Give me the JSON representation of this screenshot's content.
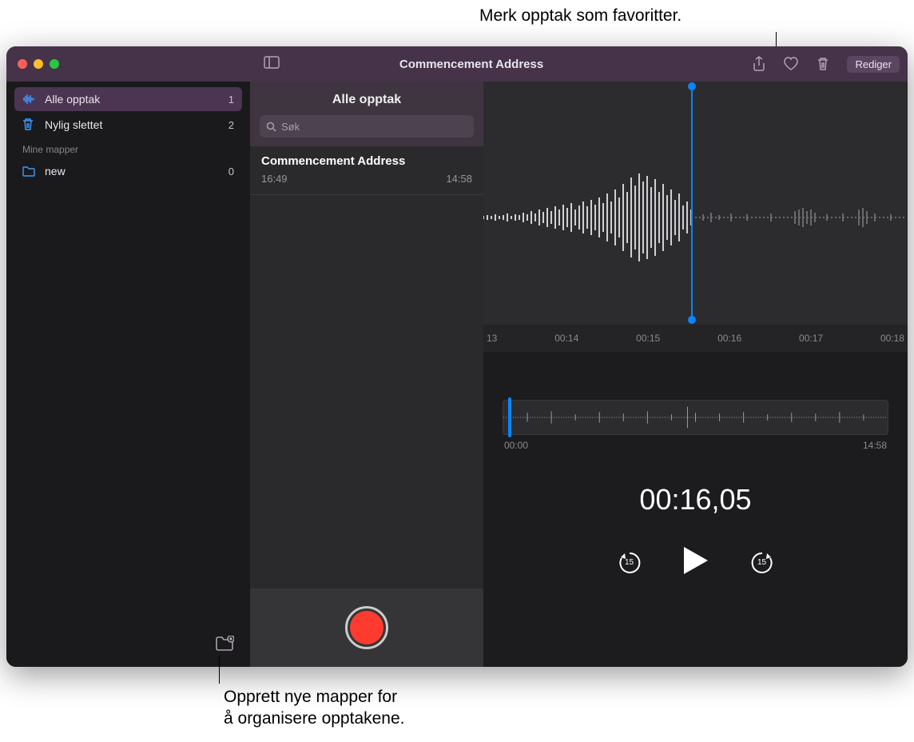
{
  "callouts": {
    "top": "Merk opptak som favoritter.",
    "bottom": "Opprett nye mapper for\nå organisere opptakene."
  },
  "titlebar": {
    "title": "Commencement Address",
    "edit_label": "Rediger"
  },
  "sidebar": {
    "items": [
      {
        "icon": "waveform",
        "label": "Alle opptak",
        "count": "1",
        "selected": true
      },
      {
        "icon": "trash",
        "label": "Nylig slettet",
        "count": "2",
        "selected": false
      }
    ],
    "folders_header": "Mine mapper",
    "folders": [
      {
        "icon": "folder",
        "label": "new",
        "count": "0"
      }
    ]
  },
  "list": {
    "header": "Alle opptak",
    "search_placeholder": "Søk",
    "items": [
      {
        "title": "Commencement Address",
        "time": "16:49",
        "duration": "14:58"
      }
    ]
  },
  "detail": {
    "ruler": [
      "13",
      "00:14",
      "00:15",
      "00:16",
      "00:17",
      "00:18"
    ],
    "overview_start": "00:00",
    "overview_end": "14:58",
    "current_time": "00:16,05",
    "skip_back_label": "15",
    "skip_fwd_label": "15"
  }
}
